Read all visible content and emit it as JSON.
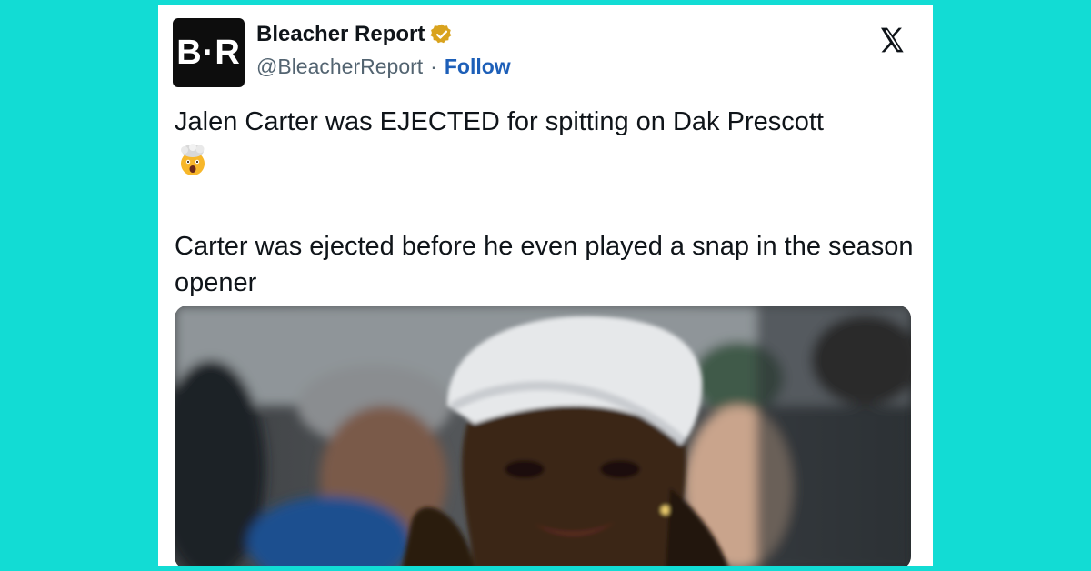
{
  "account": {
    "avatar_text": "B·R",
    "display_name": "Bleacher Report",
    "handle": "@BleacherReport",
    "separator": "·",
    "follow_label": "Follow",
    "verified": true
  },
  "tweet": {
    "line1": "Jalen Carter was EJECTED for spitting on Dak Prescott",
    "emoji_icon": "exploding-head-emoji",
    "paragraph2": "Carter was ejected before he even played a snap in the season opener"
  },
  "platform_icon": "x-logo-icon",
  "colors": {
    "background": "#12dcd4",
    "follow": "#1d5fb8",
    "verified_badge": "#d9a31e"
  }
}
